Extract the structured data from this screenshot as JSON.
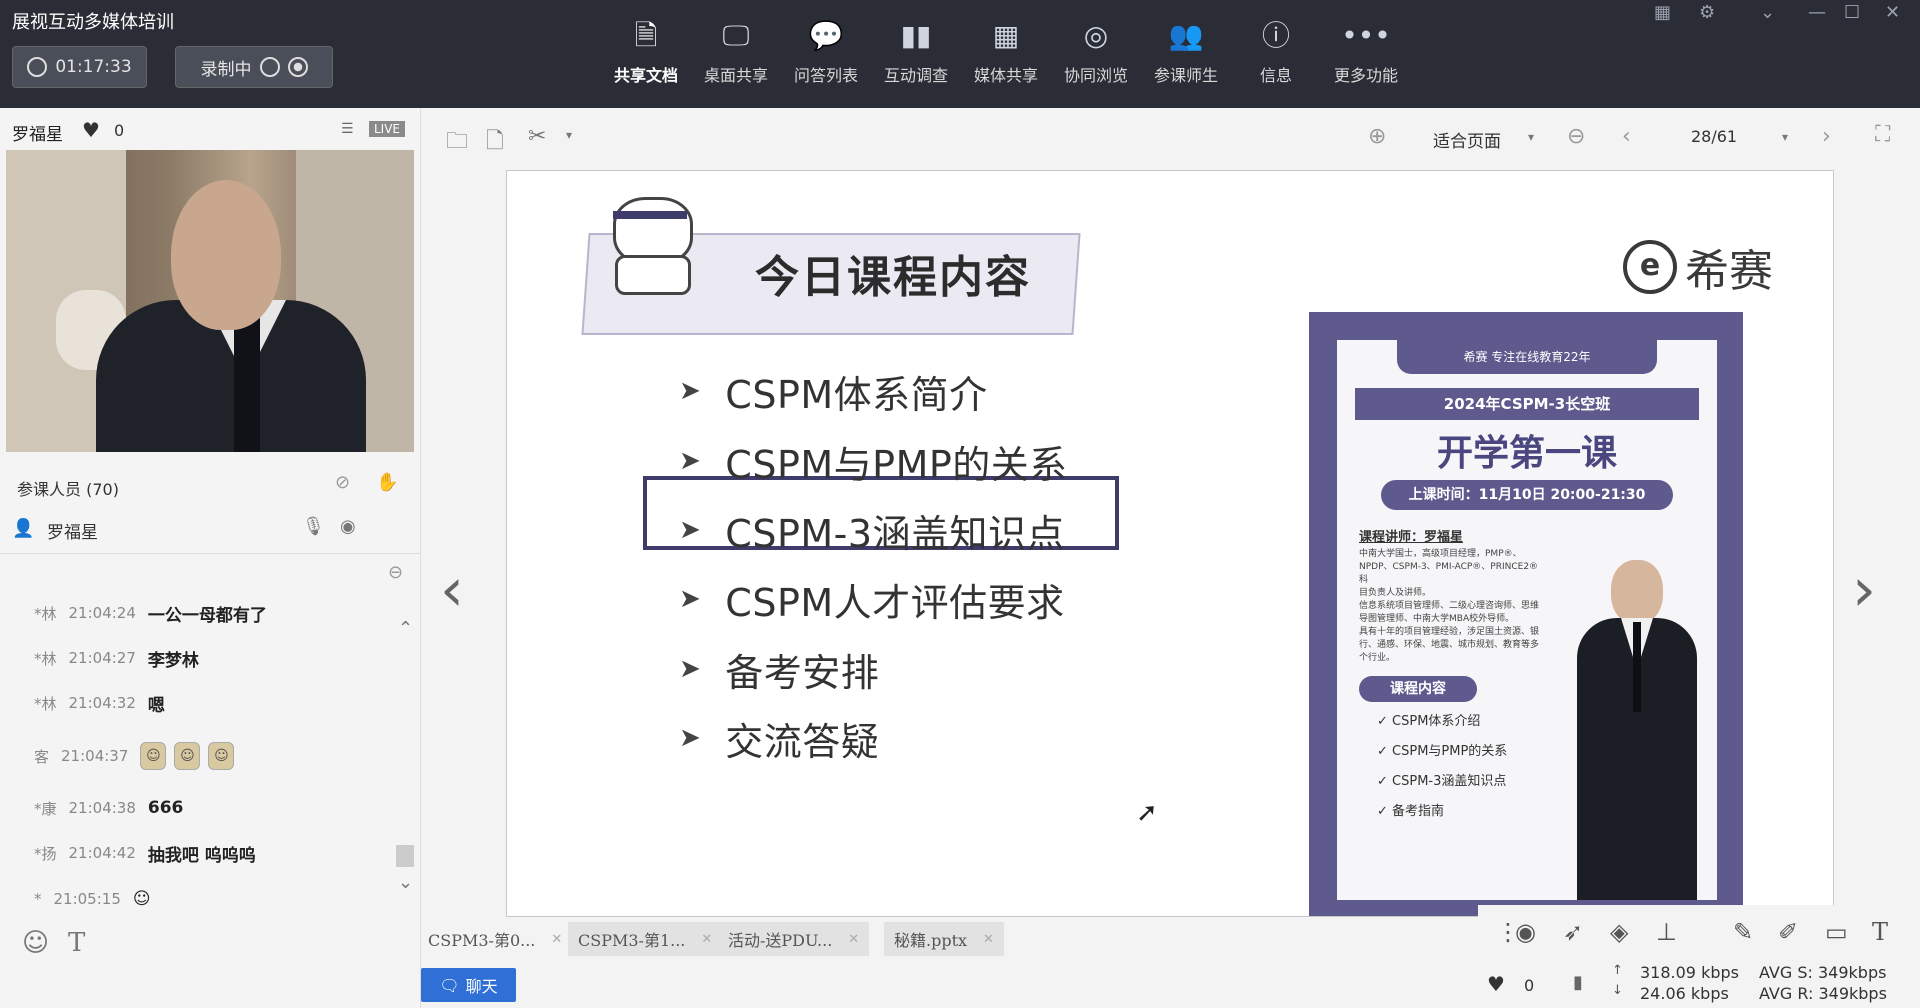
{
  "app": {
    "title": "展视互动多媒体培训"
  },
  "session": {
    "timer": "01:17:33",
    "recording_label": "录制中"
  },
  "toolbar": {
    "items": [
      {
        "label": "共享文档",
        "icon": "document-icon"
      },
      {
        "label": "桌面共享",
        "icon": "desktop-icon"
      },
      {
        "label": "问答列表",
        "icon": "qa-icon"
      },
      {
        "label": "互动调查",
        "icon": "poll-icon"
      },
      {
        "label": "媒体共享",
        "icon": "media-icon"
      },
      {
        "label": "协同浏览",
        "icon": "compass-icon"
      },
      {
        "label": "参课师生",
        "icon": "participants-icon"
      },
      {
        "label": "信息",
        "icon": "info-icon"
      },
      {
        "label": "更多功能",
        "icon": "more-icon"
      }
    ]
  },
  "presenter": {
    "name": "罗福星",
    "likes": "0",
    "live_badge": "LIVE"
  },
  "participants": {
    "header": "参课人员 (70)",
    "list": [
      {
        "name": "罗福星"
      }
    ]
  },
  "chat": {
    "messages": [
      {
        "user": "*林",
        "time": "21:04:24",
        "text": "一公一母都有了"
      },
      {
        "user": "*林",
        "time": "21:04:27",
        "text": "李梦林"
      },
      {
        "user": "*林",
        "time": "21:04:32",
        "text": "嗯"
      },
      {
        "user": "客",
        "time": "21:04:37",
        "text": ""
      },
      {
        "user": "*康",
        "time": "21:04:38",
        "text": "666"
      },
      {
        "user": "*扬",
        "time": "21:04:42",
        "text": "抽我吧 呜呜呜"
      },
      {
        "user": "*",
        "time": "21:05:15",
        "text": "☺"
      }
    ]
  },
  "doc_toolbar": {
    "zoom_label": "适合页面",
    "page": "28/61"
  },
  "slide": {
    "title": "今日课程内容",
    "brand": "希赛",
    "bullets": [
      "CSPM体系简介",
      "CSPM与PMP的关系",
      "CSPM-3涵盖知识点",
      "CSPM人才评估要求",
      "备考安排",
      "交流答疑"
    ],
    "highlighted_index": 1,
    "poster": {
      "header": "希赛 专注在线教育22年",
      "class_name": "2024年CSPM-3长空班",
      "headline": "开学第一课",
      "time": "上课时间：11月10日 20:00-21:30",
      "teacher": "课程讲师：罗福星",
      "bio": [
        "中南大学国士，高级项目经理，PMP®、",
        "NPDP、CSPM-3、PMI-ACP®、PRINCE2®科",
        "目负责人及讲师。",
        "信息系统项目管理师、二级心理咨询师、思维",
        "导图管理师、中南大学MBA校外导师。",
        "具有十年的项目管理经验，涉足国土资源、银",
        "行、通感、环保、地震、城市规划、教育等多",
        "个行业。"
      ],
      "content_label": "课程内容",
      "items": [
        "CSPM体系介绍",
        "CSPM与PMP的关系",
        "CSPM-3涵盖知识点",
        "备考指南"
      ]
    }
  },
  "files": [
    "CSPM3-第0...",
    "CSPM3-第1...",
    "活动-送PDU...",
    "秘籍.pptx"
  ],
  "chat_button": "聊天",
  "footer": {
    "likes": "0",
    "up_rate": "318.09 kbps",
    "down_rate": "24.06 kbps",
    "avg_s": "AVG S: 349kbps",
    "avg_r": "AVG R: 349kbps"
  }
}
